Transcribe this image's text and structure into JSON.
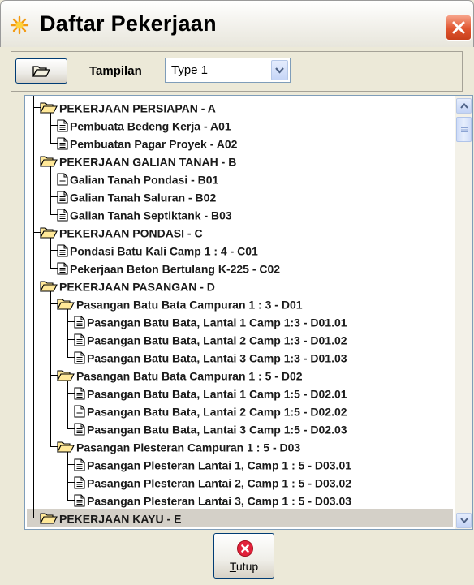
{
  "window": {
    "title": "Daftar Pekerjaan"
  },
  "toolbar": {
    "tampilan_label": "Tampilan",
    "tampilan_value": "Type 1"
  },
  "tree": [
    {
      "label": "PEKERJAAN PERSIAPAN - A",
      "type": "folder",
      "level": 0
    },
    {
      "label": "Pembuata Bedeng Kerja - A01",
      "type": "item",
      "level": 1
    },
    {
      "label": "Pembuatan Pagar Proyek - A02",
      "type": "item",
      "level": 1
    },
    {
      "label": "PEKERJAAN GALIAN TANAH - B",
      "type": "folder",
      "level": 0
    },
    {
      "label": "Galian Tanah Pondasi - B01",
      "type": "item",
      "level": 1
    },
    {
      "label": "Galian Tanah Saluran - B02",
      "type": "item",
      "level": 1
    },
    {
      "label": "Galian Tanah Septiktank - B03",
      "type": "item",
      "level": 1
    },
    {
      "label": "PEKERJAAN PONDASI - C",
      "type": "folder",
      "level": 0
    },
    {
      "label": "Pondasi Batu Kali Camp 1 : 4 - C01",
      "type": "item",
      "level": 1
    },
    {
      "label": "Pekerjaan Beton Bertulang K-225 - C02",
      "type": "item",
      "level": 1
    },
    {
      "label": "PEKERJAAN PASANGAN - D",
      "type": "folder",
      "level": 0
    },
    {
      "label": "Pasangan Batu Bata Campuran 1 : 3 - D01",
      "type": "folder",
      "level": 1
    },
    {
      "label": "Pasangan Batu Bata, Lantai 1 Camp 1:3 - D01.01",
      "type": "item",
      "level": 2
    },
    {
      "label": "Pasangan Batu Bata, Lantai 2 Camp 1:3 - D01.02",
      "type": "item",
      "level": 2
    },
    {
      "label": "Pasangan Batu Bata, Lantai 3 Camp 1:3 - D01.03",
      "type": "item",
      "level": 2
    },
    {
      "label": "Pasangan Batu Bata Campuran 1 : 5 - D02",
      "type": "folder",
      "level": 1
    },
    {
      "label": "Pasangan Batu Bata, Lantai 1 Camp 1:5 - D02.01",
      "type": "item",
      "level": 2
    },
    {
      "label": "Pasangan Batu Bata, Lantai 2 Camp 1:5 - D02.02",
      "type": "item",
      "level": 2
    },
    {
      "label": "Pasangan Batu Bata, Lantai 3 Camp 1:5 - D02.03",
      "type": "item",
      "level": 2
    },
    {
      "label": "Pasangan Plesteran Campuran 1 : 5 - D03",
      "type": "folder",
      "level": 1
    },
    {
      "label": "Pasangan Plesteran Lantai 1, Camp 1 : 5 - D03.01",
      "type": "item",
      "level": 2
    },
    {
      "label": "Pasangan Plesteran Lantai 2, Camp 1 : 5 - D03.02",
      "type": "item",
      "level": 2
    },
    {
      "label": "Pasangan Plesteran Lantai 3, Camp 1 : 5 - D03.03",
      "type": "item",
      "level": 2
    },
    {
      "label": "PEKERJAAN KAYU - E",
      "type": "folder",
      "level": 0,
      "selected": true
    }
  ],
  "footer": {
    "close_label": "Tutup"
  }
}
